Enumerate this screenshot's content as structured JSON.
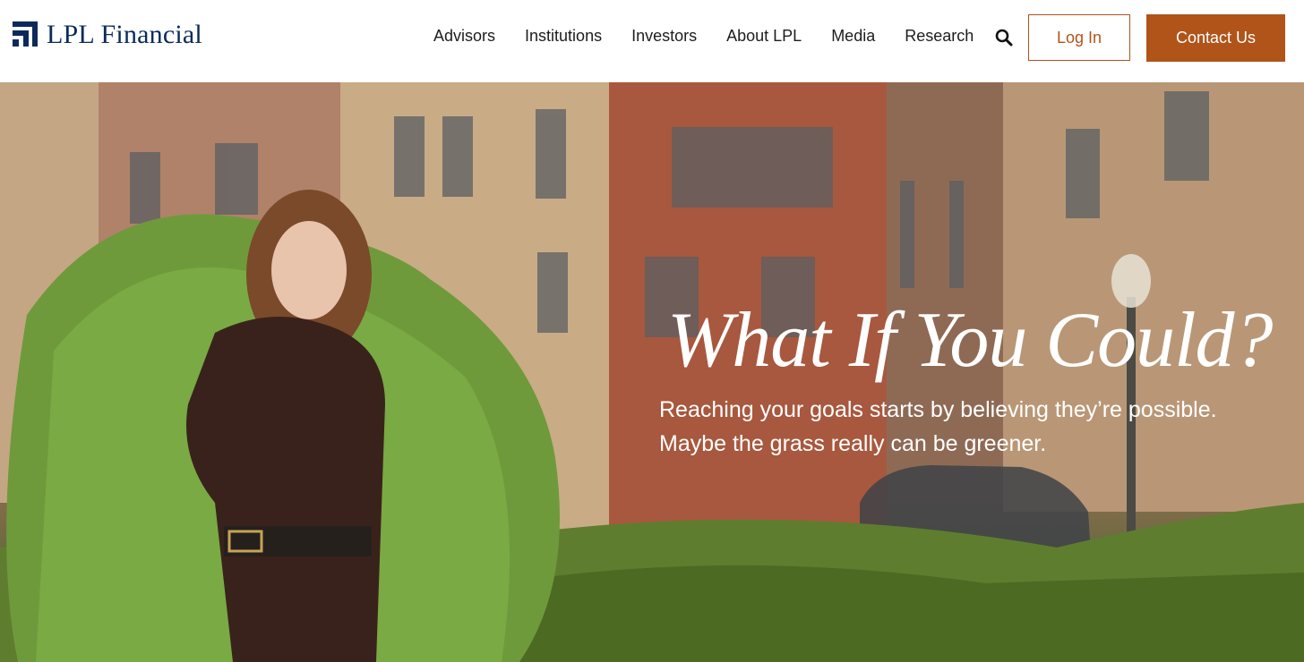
{
  "header": {
    "brand": "LPL Financial",
    "nav": [
      "Advisors",
      "Institutions",
      "Investors",
      "About LPL",
      "Media",
      "Research"
    ],
    "login_label": "Log In",
    "contact_label": "Contact Us",
    "search_icon": "search-icon",
    "accent_color": "#b0541a",
    "brand_color": "#0b2a5b"
  },
  "hero": {
    "title": "What If You Could?",
    "line1": "Reaching your goals starts by believing they’re possible.",
    "line2": "Maybe the grass really can be greener."
  }
}
